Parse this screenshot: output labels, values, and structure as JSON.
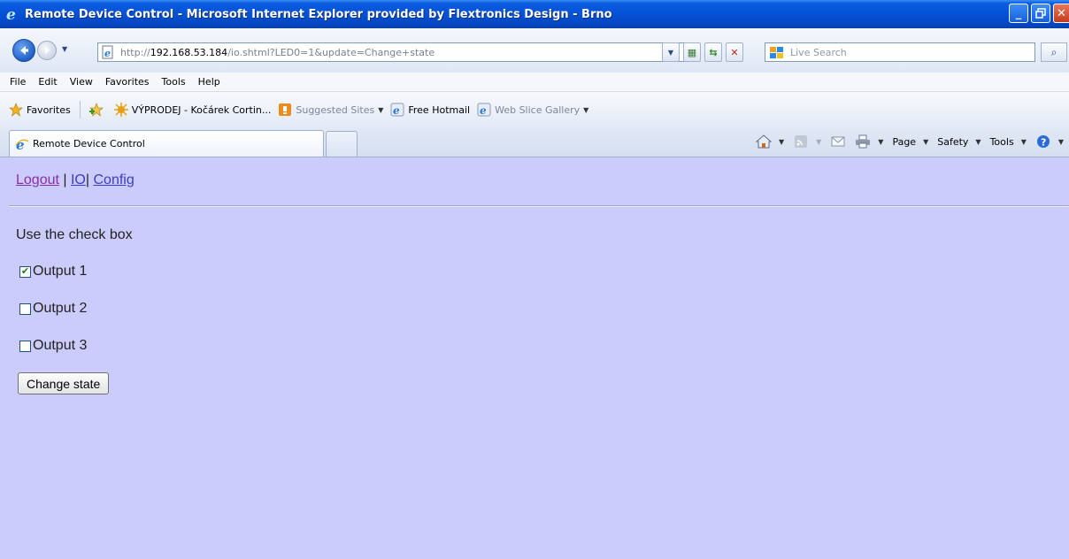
{
  "window": {
    "title": "Remote Device Control - Microsoft Internet Explorer provided by Flextronics Design - Brno"
  },
  "address": {
    "prefix": "http://",
    "host": "192.168.53.184",
    "path": "/io.shtml?LED0=1&update=Change+state"
  },
  "search": {
    "placeholder": "Live Search"
  },
  "menu": [
    "File",
    "Edit",
    "View",
    "Favorites",
    "Tools",
    "Help"
  ],
  "favorites": {
    "label": "Favorites",
    "items": [
      {
        "label": "VÝPRODEJ - Kočárek Cortin..."
      },
      {
        "label": "Suggested Sites"
      },
      {
        "label": "Free Hotmail"
      },
      {
        "label": "Web Slice Gallery"
      }
    ]
  },
  "tab": {
    "label": "Remote Device Control"
  },
  "commands": {
    "page": "Page",
    "safety": "Safety",
    "tools": "Tools"
  },
  "content": {
    "links": {
      "logout": "Logout",
      "sep1": " | ",
      "io": "IO",
      "sep2": "| ",
      "config": "Config"
    },
    "instruction": "Use the check box",
    "outputs": [
      {
        "label": "Output 1",
        "checked": true
      },
      {
        "label": "Output 2",
        "checked": false
      },
      {
        "label": "Output 3",
        "checked": false
      }
    ],
    "submit_label": "Change state"
  },
  "colors": {
    "page_background": "#ccccfc",
    "titlebar": "#0551d6",
    "link": "#3a3cc6",
    "visited_link": "#8a2ea8"
  }
}
